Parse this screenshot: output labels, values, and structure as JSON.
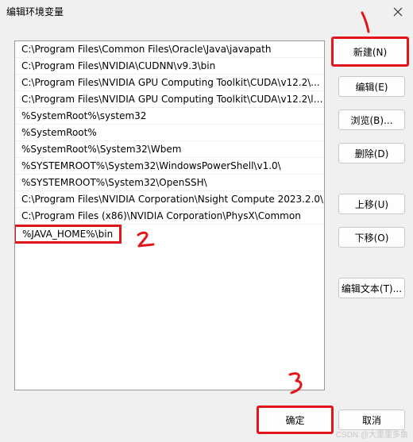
{
  "window": {
    "title": "编辑环境变量",
    "close_icon": "close-icon"
  },
  "paths": [
    "C:\\Program Files\\Common Files\\Oracle\\Java\\javapath",
    "C:\\Program Files\\NVIDIA\\CUDNN\\v9.3\\bin",
    "C:\\Program Files\\NVIDIA GPU Computing Toolkit\\CUDA\\v12.2\\...",
    "C:\\Program Files\\NVIDIA GPU Computing Toolkit\\CUDA\\v12.2\\li...",
    "%SystemRoot%\\system32",
    "%SystemRoot%",
    "%SystemRoot%\\System32\\Wbem",
    "%SYSTEMROOT%\\System32\\WindowsPowerShell\\v1.0\\",
    "%SYSTEMROOT%\\System32\\OpenSSH\\",
    "C:\\Program Files\\NVIDIA Corporation\\Nsight Compute 2023.2.0\\",
    "C:\\Program Files (x86)\\NVIDIA Corporation\\PhysX\\Common",
    "%JAVA_HOME%\\bin"
  ],
  "buttons": {
    "new": "新建(N)",
    "edit": "编辑(E)",
    "browse": "浏览(B)...",
    "delete": "删除(D)",
    "up": "上移(U)",
    "down": "下移(O)",
    "edit_text": "编辑文本(T)...",
    "ok": "确定",
    "cancel": "取消"
  },
  "annotations": {
    "step1": "1",
    "step2": "2",
    "step3": "3",
    "color": "#e0161b"
  },
  "watermark": "CSDN @大里里多鱼"
}
